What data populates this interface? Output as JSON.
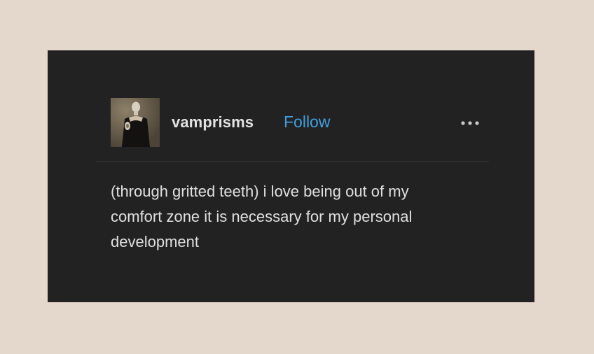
{
  "post": {
    "author": {
      "username": "vamprisms",
      "follow_label": "Follow",
      "avatar_icon": "avatar-image"
    },
    "more_icon": "more-options-icon",
    "lines": [
      "(through gritted teeth) i love being out of my",
      "comfort zone it is necessary for my personal",
      "development"
    ]
  },
  "colors": {
    "page_background": "#e4d8cc",
    "card_background": "#222222",
    "text": "#e0e0e0",
    "follow": "#3f9fe0"
  }
}
